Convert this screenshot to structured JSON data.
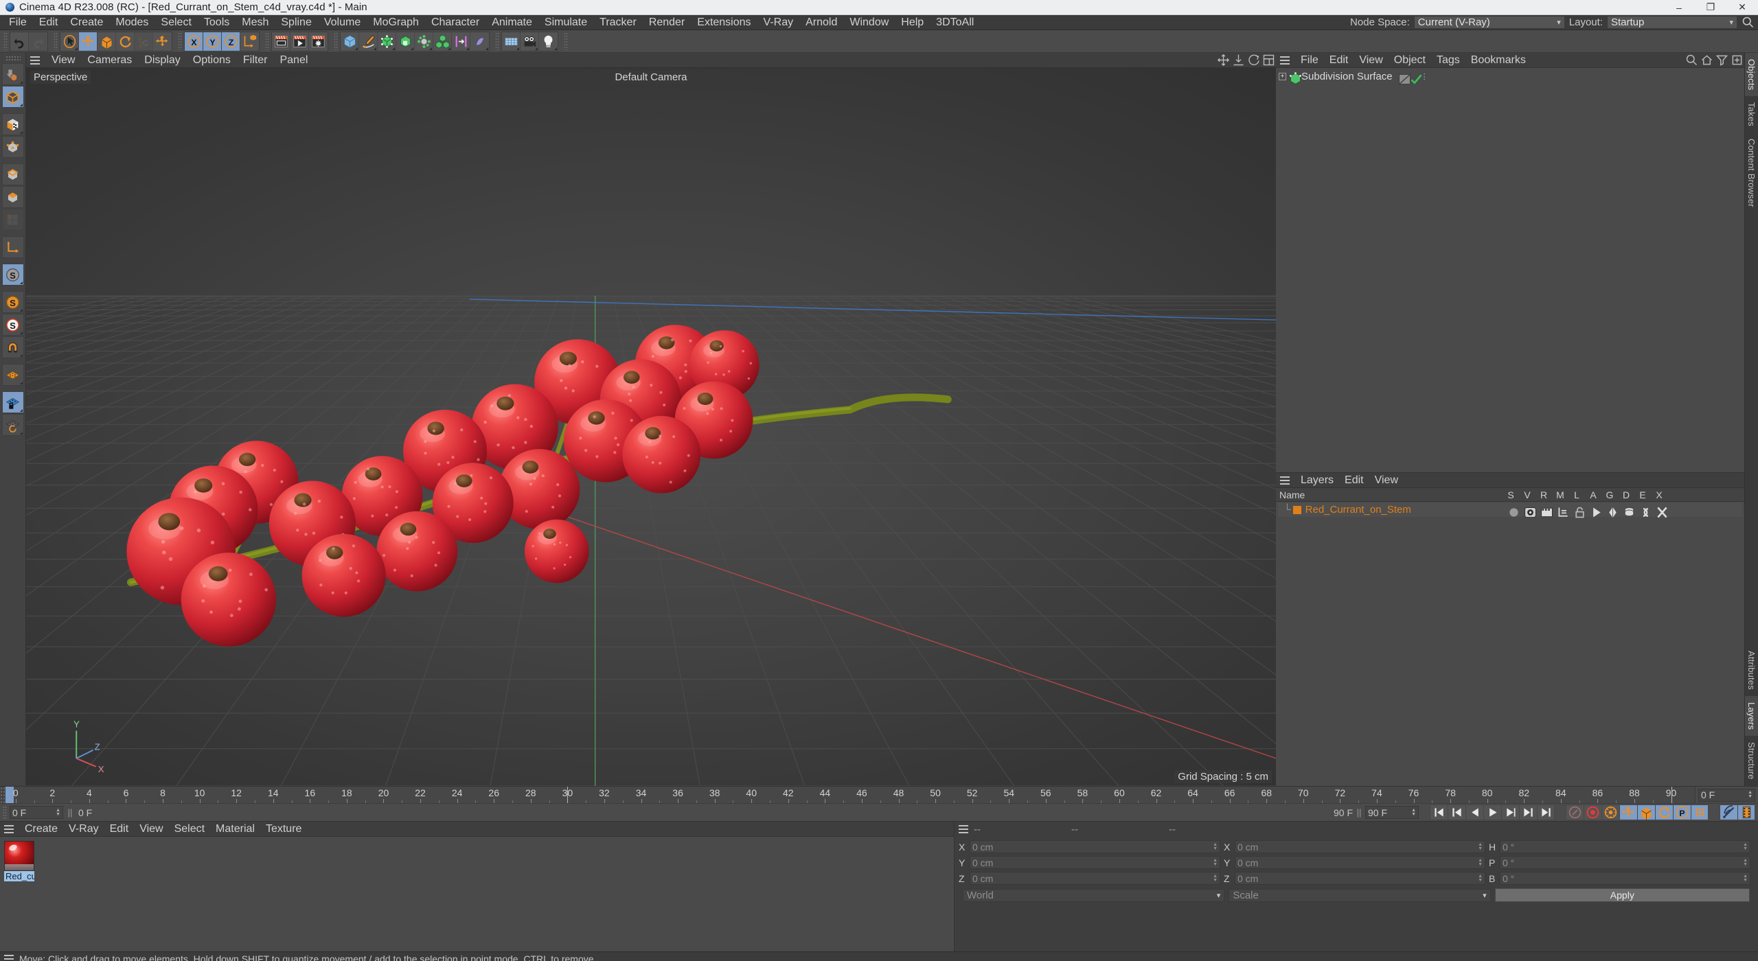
{
  "titlebar": {
    "text": "Cinema 4D R23.008 (RC) - [Red_Currant_on_Stem_c4d_vray.c4d *] - Main",
    "minimize": "–",
    "maximize": "❐",
    "close": "✕"
  },
  "menubar": {
    "items": [
      "File",
      "Edit",
      "Create",
      "Modes",
      "Select",
      "Tools",
      "Mesh",
      "Spline",
      "Volume",
      "MoGraph",
      "Character",
      "Animate",
      "Simulate",
      "Tracker",
      "Render",
      "Extensions",
      "V-Ray",
      "Arnold",
      "Window",
      "Help",
      "3DToAll"
    ],
    "node_space_label": "Node Space:",
    "node_space_value": "Current (V-Ray)",
    "layout_label": "Layout:",
    "layout_value": "Startup"
  },
  "toolbar": {
    "groups": [
      {
        "buttons": [
          {
            "name": "undo-button",
            "icon": "undo",
            "state": "normal"
          },
          {
            "name": "redo-button",
            "icon": "redo",
            "state": "disabled"
          }
        ]
      },
      {
        "buttons": [
          {
            "name": "live-selection-button",
            "icon": "cursor-circle",
            "state": "normal",
            "corner": true
          },
          {
            "name": "move-tool-button",
            "icon": "move",
            "state": "selected"
          },
          {
            "name": "scale-tool-button",
            "icon": "scale",
            "state": "normal"
          },
          {
            "name": "rotate-tool-button",
            "icon": "rotate",
            "state": "normal"
          },
          {
            "name": "psr-tool-button",
            "icon": "psr",
            "state": "disabled"
          },
          {
            "name": "move-alt-button",
            "icon": "move",
            "state": "normal"
          }
        ]
      },
      {
        "buttons": [
          {
            "name": "x-axis-lock-button",
            "icon": "axis-x",
            "state": "selected"
          },
          {
            "name": "y-axis-lock-button",
            "icon": "axis-y",
            "state": "selected"
          },
          {
            "name": "z-axis-lock-button",
            "icon": "axis-z",
            "state": "selected"
          },
          {
            "name": "world-object-coordinates-button",
            "icon": "world-axis",
            "state": "normal"
          }
        ]
      },
      {
        "buttons": [
          {
            "name": "render-view-button",
            "icon": "render-view",
            "state": "normal"
          },
          {
            "name": "render-to-picture-viewer-button",
            "icon": "render-picture",
            "state": "normal"
          },
          {
            "name": "render-settings-button",
            "icon": "render-settings",
            "state": "normal"
          }
        ]
      },
      {
        "buttons": [
          {
            "name": "add-cube-object-button",
            "icon": "cube-blue",
            "state": "normal",
            "corner": true
          },
          {
            "name": "add-spline-pen-button",
            "icon": "pen",
            "state": "normal",
            "corner": true
          },
          {
            "name": "add-subdivision-surface-button",
            "icon": "subdiv-green",
            "state": "normal",
            "corner": true
          },
          {
            "name": "add-array-button",
            "icon": "array-green",
            "state": "normal",
            "corner": true
          },
          {
            "name": "add-cloner-button",
            "icon": "cloner-gray",
            "state": "normal",
            "corner": true
          },
          {
            "name": "add-mograph-button",
            "icon": "cubes-green",
            "state": "normal",
            "corner": true
          },
          {
            "name": "add-deformer-button",
            "icon": "bend-magenta",
            "state": "normal",
            "corner": true
          },
          {
            "name": "add-field-button",
            "icon": "field-purple",
            "state": "normal",
            "corner": true
          }
        ]
      },
      {
        "buttons": [
          {
            "name": "add-floor-button",
            "icon": "floor-grid",
            "state": "normal",
            "corner": true
          },
          {
            "name": "add-camera-button",
            "icon": "camera",
            "state": "normal",
            "corner": true
          },
          {
            "name": "add-light-button",
            "icon": "light-bulb",
            "state": "normal",
            "corner": true
          }
        ]
      }
    ]
  },
  "lefttools": {
    "items": [
      {
        "name": "move-down-tool",
        "icon": "cubes-shadow",
        "state": "normal",
        "corner": true
      },
      {
        "name": "model-mode-tool",
        "icon": "cube-orange-outline",
        "state": "selected",
        "corner": true
      },
      {
        "name": "texture-mode-tool",
        "icon": "cube-checker",
        "state": "normal",
        "corner": true
      },
      {
        "name": "points-mode-tool",
        "icon": "cube-points",
        "state": "normal"
      },
      {
        "name": "edges-mode-tool",
        "icon": "cube-edges",
        "state": "normal"
      },
      {
        "name": "polygons-mode-tool",
        "icon": "cube-poly",
        "state": "normal"
      },
      {
        "name": "uv-mode-tool",
        "icon": "uv-squares",
        "state": "disabled"
      },
      {
        "name": "axis-mode-tool",
        "icon": "axis-l",
        "state": "normal"
      },
      {
        "name": "enable-axis-tool",
        "icon": "s-gray",
        "state": "selected",
        "corner": true
      },
      {
        "name": "object-axis-tool",
        "icon": "s-orange",
        "state": "normal",
        "corner": true
      },
      {
        "name": "viewport-solo-tool",
        "icon": "s-white",
        "state": "normal",
        "corner": true
      },
      {
        "name": "snap-magnet-tool",
        "icon": "magnet",
        "state": "normal",
        "corner": true
      },
      {
        "name": "workplane-tool",
        "icon": "grid-orange",
        "state": "normal",
        "corner": true
      },
      {
        "name": "lock-workplane-tool",
        "icon": "grid-lock",
        "state": "selected",
        "corner": true
      },
      {
        "name": "planar-workplane-tool",
        "icon": "grid-rotate",
        "state": "normal",
        "corner": true
      }
    ]
  },
  "viewport": {
    "menu": [
      "View",
      "Cameras",
      "Display",
      "Options",
      "Filter",
      "Panel"
    ],
    "corner_icons": [
      "pan-icon",
      "dolly-icon",
      "rotate-icon",
      "maximize-icon"
    ],
    "perspective_label": "Perspective",
    "camera_label": "Default Camera",
    "grid_spacing_label": "Grid Spacing : 5 cm",
    "axis_gizmo": {
      "y": "Y",
      "z": "Z",
      "x": "X"
    },
    "scene": {
      "title": "Red currant berries on a stem",
      "berry_color": "#e2393f",
      "berry_highlight": "#f8787a",
      "berry_shadow": "#8b1118",
      "stem_color": "#7e8c1e",
      "calyx_color": "#6b4226",
      "berry_count": 20
    }
  },
  "objectmanager": {
    "menu": [
      "File",
      "Edit",
      "View",
      "Object",
      "Tags",
      "Bookmarks"
    ],
    "corner_icons": [
      "search-icon",
      "home-icon",
      "filter-icon",
      "new-tab-icon"
    ],
    "tree": [
      {
        "name": "Subdivision Surface",
        "expandable": true,
        "icon": "subdivision-surface-icon",
        "tags": [
          "display-tag",
          "visibility-check"
        ]
      }
    ],
    "tab_labels": [
      "Objects",
      "Takes",
      "Content Browser"
    ]
  },
  "layersmanager": {
    "menu": [
      "Layers",
      "Edit",
      "View"
    ],
    "columns": [
      "Name",
      "S",
      "V",
      "R",
      "M",
      "L",
      "A",
      "G",
      "D",
      "E",
      "X"
    ],
    "rows": [
      {
        "name": "Red_Currant_on_Stem",
        "color": "#e08019",
        "flags": [
          "solo-dot",
          "visible-eye",
          "render-film",
          "manager-tree",
          "lock-open",
          "animation-play",
          "generator",
          "deformer",
          "expression",
          "xref"
        ]
      }
    ],
    "tab_labels": [
      "Attributes",
      "Layers",
      "Structure"
    ]
  },
  "timeline": {
    "ticks": [
      0,
      2,
      4,
      6,
      8,
      10,
      12,
      14,
      16,
      18,
      20,
      22,
      24,
      26,
      28,
      30,
      32,
      34,
      36,
      38,
      40,
      42,
      44,
      46,
      48,
      50,
      52,
      54,
      56,
      58,
      60,
      62,
      64,
      66,
      68,
      70,
      72,
      74,
      76,
      78,
      80,
      82,
      84,
      86,
      88,
      90
    ],
    "current_frame": "0 F",
    "current_frame2": "0 F",
    "preview_start": "0 F",
    "preview_start2": "0 F",
    "end_frame": "90 F",
    "end_frame2": "90 F",
    "range_end_field": "0 F",
    "transport": [
      {
        "name": "go-to-start-button",
        "icon": "skip-start"
      },
      {
        "name": "previous-key-button",
        "icon": "prev-key"
      },
      {
        "name": "step-back-button",
        "icon": "step-back"
      },
      {
        "name": "play-button",
        "icon": "play"
      },
      {
        "name": "step-forward-button",
        "icon": "step-fwd"
      },
      {
        "name": "next-key-button",
        "icon": "next-key"
      },
      {
        "name": "go-to-end-button",
        "icon": "skip-end"
      }
    ],
    "record_tools": [
      {
        "name": "autokey-button",
        "icon": "key-gray"
      },
      {
        "name": "record-active-objects-button",
        "icon": "record-red"
      },
      {
        "name": "keyframe-settings-button",
        "icon": "gear-orange"
      },
      {
        "name": "position-key-button",
        "icon": "move",
        "selected": true
      },
      {
        "name": "scale-key-button",
        "icon": "scale",
        "selected": true
      },
      {
        "name": "rotation-key-button",
        "icon": "rotate",
        "selected": true
      },
      {
        "name": "parameter-key-button",
        "icon": "param-p",
        "selected": true
      },
      {
        "name": "point-level-animation-button",
        "icon": "pla-dots",
        "selected": true
      }
    ],
    "right_tools": [
      {
        "name": "dynamics-playback-button",
        "icon": "signal",
        "selected": true
      },
      {
        "name": "timeline-button",
        "icon": "filmstrip",
        "selected": true
      }
    ]
  },
  "materialmanager": {
    "menu": [
      "Create",
      "V-Ray",
      "Edit",
      "View",
      "Select",
      "Material",
      "Texture"
    ],
    "materials": [
      {
        "name": "Red_curr",
        "full_name": "Red_currant",
        "selected": true
      }
    ]
  },
  "coordinates": {
    "headers": [
      "--",
      "--",
      "--"
    ],
    "position": {
      "label_x": "X",
      "x": "0 cm",
      "label_y": "Y",
      "y": "0 cm",
      "label_z": "Z",
      "z": "0 cm"
    },
    "size": {
      "label_x": "X",
      "x": "0 cm",
      "label_y": "Y",
      "y": "0 cm",
      "label_z": "Z",
      "z": "0 cm"
    },
    "rotation": {
      "label_h": "H",
      "h": "0 °",
      "label_p": "P",
      "p": "0 °",
      "label_b": "B",
      "b": "0 °"
    },
    "coord_system": "World",
    "size_mode": "Scale",
    "apply_label": "Apply"
  },
  "statusbar": {
    "text": "Move: Click and drag to move elements. Hold down SHIFT to quantize movement / add to the selection in point mode, CTRL to remove."
  }
}
